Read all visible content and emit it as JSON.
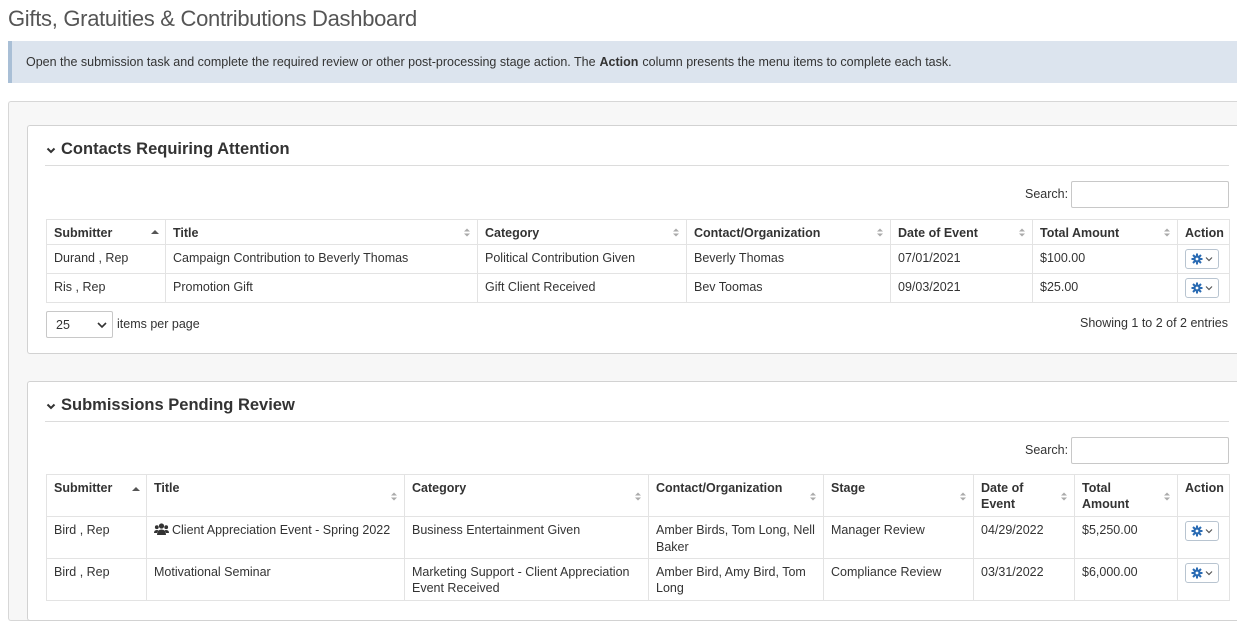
{
  "page": {
    "title": "Gifts, Gratuities & Contributions Dashboard"
  },
  "banner": {
    "text_before": "Open the submission task and complete the required review or other post-processing stage action. The",
    "bold": "Action",
    "text_after": "column presents the menu items to complete each task."
  },
  "contacts_panel": {
    "title": "Contacts Requiring Attention",
    "search_label": "Search:",
    "search_value": "",
    "columns": [
      "Submitter",
      "Title",
      "Category",
      "Contact/Organization",
      "Date of Event",
      "Total Amount",
      "Action"
    ],
    "rows": [
      {
        "submitter": "Durand , Rep",
        "title": "Campaign Contribution to Beverly Thomas",
        "category": "Political Contribution Given",
        "contact": "Beverly Thomas",
        "date": "07/01/2021",
        "amount": "$100.00"
      },
      {
        "submitter": "Ris , Rep",
        "title": "Promotion Gift",
        "category": "Gift Client Received",
        "contact": "Bev Toomas",
        "date": "09/03/2021",
        "amount": "$25.00"
      }
    ],
    "per_page_value": "25",
    "per_page_label": "items per page",
    "entries_info": "Showing 1 to 2 of 2 entries"
  },
  "pending_panel": {
    "title": "Submissions Pending Review",
    "search_label": "Search:",
    "search_value": "",
    "columns": [
      "Submitter",
      "Title",
      "Category",
      "Contact/Organization",
      "Stage",
      "Date of Event",
      "Total Amount",
      "Action"
    ],
    "rows": [
      {
        "submitter": "Bird , Rep",
        "title": "Client Appreciation Event - Spring 2022",
        "title_icon": "group-icon",
        "category": "Business Entertainment Given",
        "contact": "Amber Birds, Tom Long, Nell Baker",
        "stage": "Manager Review",
        "date": "04/29/2022",
        "amount": "$5,250.00"
      },
      {
        "submitter": "Bird , Rep",
        "title": "Motivational Seminar",
        "category": "Marketing Support - Client Appreciation Event Received",
        "contact": "Amber Bird, Amy Bird, Tom Long",
        "stage": "Compliance Review",
        "date": "03/31/2022",
        "amount": "$6,000.00"
      }
    ]
  },
  "icons": {
    "collapse": "chevron-down-icon",
    "sort": "sort-icon",
    "action": "gear-icon",
    "group": "group-icon"
  },
  "colors": {
    "banner_bg": "#dce4ee",
    "action_icon": "#2a6bb3"
  }
}
